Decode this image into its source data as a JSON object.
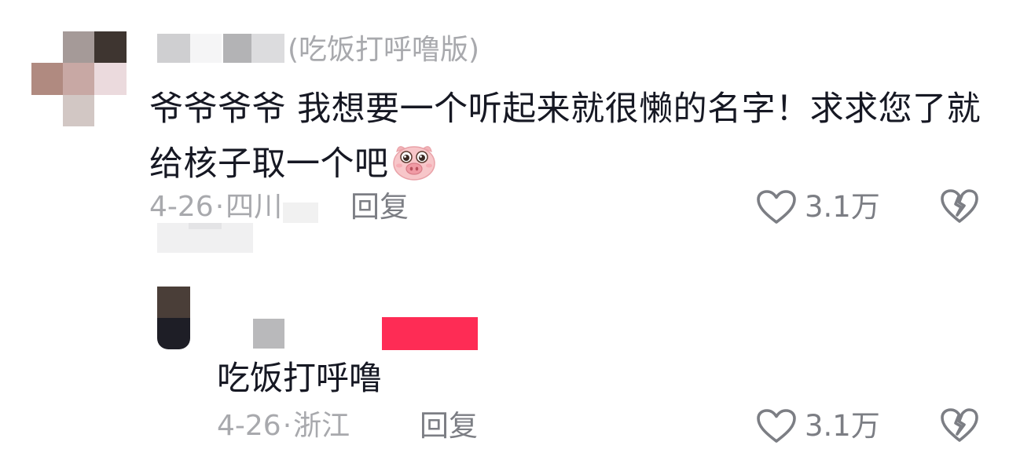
{
  "comments": [
    {
      "name_suffix": "(吃饭打呼噜版)",
      "text": "爷爷爷爷 我想要一个听起来就很懒的名字！求求您了就给核子取一个吧",
      "emoji": "pig-face-emoji",
      "date": "4-26",
      "separator": "·",
      "location": "四川",
      "reply_label": "回复",
      "like_count": "3.1万",
      "like_icon": "heart-outline-icon",
      "dislike_icon": "broken-heart-icon"
    },
    {
      "text": "吃饭打呼噜",
      "date": "4-26",
      "separator": "·",
      "location": "浙江",
      "reply_label": "回复",
      "like_count": "3.1万",
      "like_icon": "heart-outline-icon",
      "dislike_icon": "broken-heart-icon"
    }
  ],
  "colors": {
    "primary_text": "#161823",
    "secondary_text": "#a8a9ad",
    "action_text": "#7c7e84",
    "author_badge": "#fe2c55"
  }
}
